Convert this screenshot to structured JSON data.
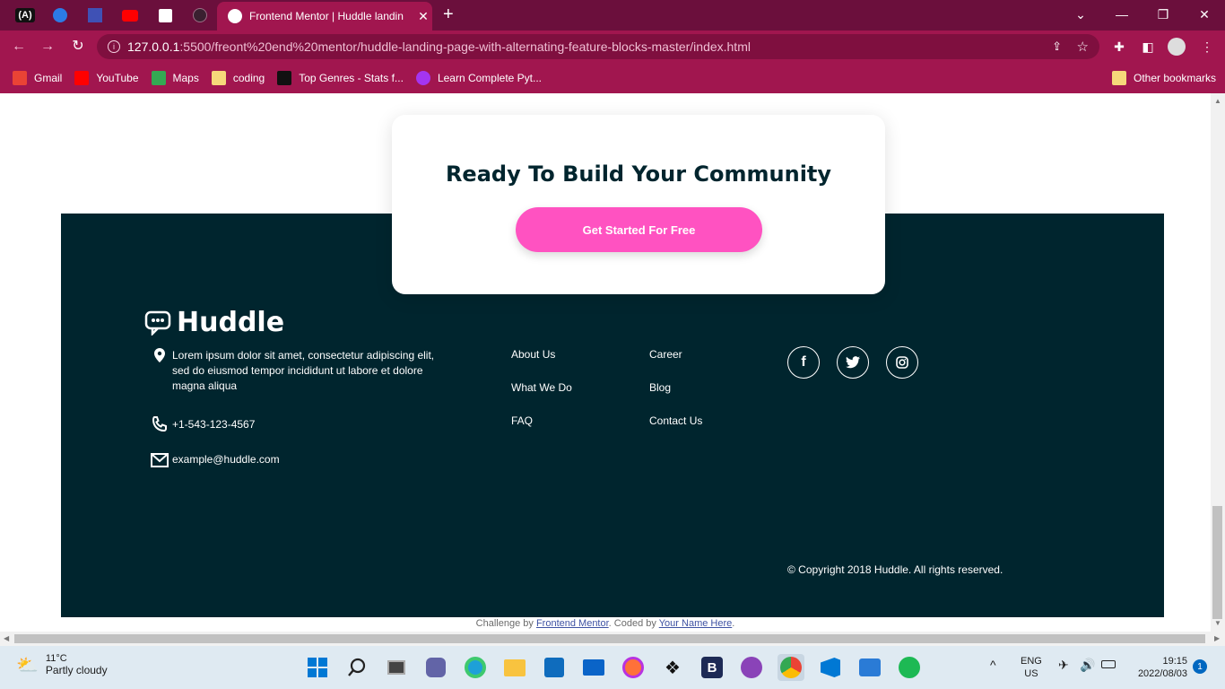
{
  "browser": {
    "active_tab_title": "Frontend Mentor | Huddle landin",
    "url_host": "127.0.0.1",
    "url_path": ":5500/freont%20end%20mentor/huddle-landing-page-with-alternating-feature-blocks-master/index.html",
    "bookmarks": [
      {
        "label": "Gmail",
        "icon": "gmail-icon",
        "color": "#ea4335"
      },
      {
        "label": "YouTube",
        "icon": "youtube-icon",
        "color": "#ff0000"
      },
      {
        "label": "Maps",
        "icon": "maps-icon",
        "color": "#34a853"
      },
      {
        "label": "coding",
        "icon": "folder-icon",
        "color": "#f6d87a"
      },
      {
        "label": "Top Genres - Stats f...",
        "icon": "stats-icon",
        "color": "#111111"
      },
      {
        "label": "Learn Complete Pyt...",
        "icon": "udemy-icon",
        "color": "#a435f0"
      }
    ],
    "other_bookmarks": "Other bookmarks"
  },
  "cta": {
    "title": "Ready To Build Your Community",
    "button": "Get Started For Free"
  },
  "footer": {
    "logo": "Huddle",
    "address": "Lorem ipsum dolor sit amet, consectetur adipiscing elit, sed do eiusmod tempor incididunt ut labore et dolore magna aliqua",
    "phone": "+1-543-123-4567",
    "email": "example@huddle.com",
    "links": [
      "About Us",
      "What We Do",
      "FAQ",
      "Career",
      "Blog",
      "Contact Us"
    ],
    "copyright": "© Copyright 2018 Huddle. All rights reserved."
  },
  "attribution": {
    "prefix": "Challenge by ",
    "link1": "Frontend Mentor",
    "middle": ". Coded by ",
    "link2": "Your Name Here",
    "suffix": "."
  },
  "taskbar": {
    "temperature": "11°C",
    "weather": "Partly cloudy",
    "lang1": "ENG",
    "lang2": "US",
    "time": "19:15",
    "date": "2022/08/03",
    "notifications": "1"
  },
  "colors": {
    "accent": "#ff52c1",
    "footer_bg": "#00252e",
    "browser_frame": "#a1164f"
  }
}
